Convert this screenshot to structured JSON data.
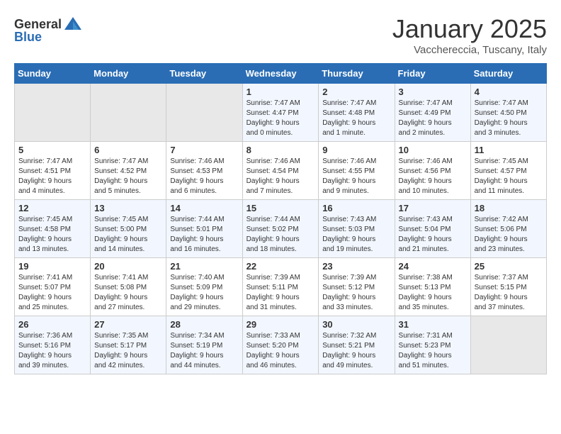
{
  "header": {
    "logo_general": "General",
    "logo_blue": "Blue",
    "month": "January 2025",
    "location": "Vacchereccia, Tuscany, Italy"
  },
  "days_of_week": [
    "Sunday",
    "Monday",
    "Tuesday",
    "Wednesday",
    "Thursday",
    "Friday",
    "Saturday"
  ],
  "weeks": [
    [
      {
        "day": "",
        "info": ""
      },
      {
        "day": "",
        "info": ""
      },
      {
        "day": "",
        "info": ""
      },
      {
        "day": "1",
        "info": "Sunrise: 7:47 AM\nSunset: 4:47 PM\nDaylight: 9 hours\nand 0 minutes."
      },
      {
        "day": "2",
        "info": "Sunrise: 7:47 AM\nSunset: 4:48 PM\nDaylight: 9 hours\nand 1 minute."
      },
      {
        "day": "3",
        "info": "Sunrise: 7:47 AM\nSunset: 4:49 PM\nDaylight: 9 hours\nand 2 minutes."
      },
      {
        "day": "4",
        "info": "Sunrise: 7:47 AM\nSunset: 4:50 PM\nDaylight: 9 hours\nand 3 minutes."
      }
    ],
    [
      {
        "day": "5",
        "info": "Sunrise: 7:47 AM\nSunset: 4:51 PM\nDaylight: 9 hours\nand 4 minutes."
      },
      {
        "day": "6",
        "info": "Sunrise: 7:47 AM\nSunset: 4:52 PM\nDaylight: 9 hours\nand 5 minutes."
      },
      {
        "day": "7",
        "info": "Sunrise: 7:46 AM\nSunset: 4:53 PM\nDaylight: 9 hours\nand 6 minutes."
      },
      {
        "day": "8",
        "info": "Sunrise: 7:46 AM\nSunset: 4:54 PM\nDaylight: 9 hours\nand 7 minutes."
      },
      {
        "day": "9",
        "info": "Sunrise: 7:46 AM\nSunset: 4:55 PM\nDaylight: 9 hours\nand 9 minutes."
      },
      {
        "day": "10",
        "info": "Sunrise: 7:46 AM\nSunset: 4:56 PM\nDaylight: 9 hours\nand 10 minutes."
      },
      {
        "day": "11",
        "info": "Sunrise: 7:45 AM\nSunset: 4:57 PM\nDaylight: 9 hours\nand 11 minutes."
      }
    ],
    [
      {
        "day": "12",
        "info": "Sunrise: 7:45 AM\nSunset: 4:58 PM\nDaylight: 9 hours\nand 13 minutes."
      },
      {
        "day": "13",
        "info": "Sunrise: 7:45 AM\nSunset: 5:00 PM\nDaylight: 9 hours\nand 14 minutes."
      },
      {
        "day": "14",
        "info": "Sunrise: 7:44 AM\nSunset: 5:01 PM\nDaylight: 9 hours\nand 16 minutes."
      },
      {
        "day": "15",
        "info": "Sunrise: 7:44 AM\nSunset: 5:02 PM\nDaylight: 9 hours\nand 18 minutes."
      },
      {
        "day": "16",
        "info": "Sunrise: 7:43 AM\nSunset: 5:03 PM\nDaylight: 9 hours\nand 19 minutes."
      },
      {
        "day": "17",
        "info": "Sunrise: 7:43 AM\nSunset: 5:04 PM\nDaylight: 9 hours\nand 21 minutes."
      },
      {
        "day": "18",
        "info": "Sunrise: 7:42 AM\nSunset: 5:06 PM\nDaylight: 9 hours\nand 23 minutes."
      }
    ],
    [
      {
        "day": "19",
        "info": "Sunrise: 7:41 AM\nSunset: 5:07 PM\nDaylight: 9 hours\nand 25 minutes."
      },
      {
        "day": "20",
        "info": "Sunrise: 7:41 AM\nSunset: 5:08 PM\nDaylight: 9 hours\nand 27 minutes."
      },
      {
        "day": "21",
        "info": "Sunrise: 7:40 AM\nSunset: 5:09 PM\nDaylight: 9 hours\nand 29 minutes."
      },
      {
        "day": "22",
        "info": "Sunrise: 7:39 AM\nSunset: 5:11 PM\nDaylight: 9 hours\nand 31 minutes."
      },
      {
        "day": "23",
        "info": "Sunrise: 7:39 AM\nSunset: 5:12 PM\nDaylight: 9 hours\nand 33 minutes."
      },
      {
        "day": "24",
        "info": "Sunrise: 7:38 AM\nSunset: 5:13 PM\nDaylight: 9 hours\nand 35 minutes."
      },
      {
        "day": "25",
        "info": "Sunrise: 7:37 AM\nSunset: 5:15 PM\nDaylight: 9 hours\nand 37 minutes."
      }
    ],
    [
      {
        "day": "26",
        "info": "Sunrise: 7:36 AM\nSunset: 5:16 PM\nDaylight: 9 hours\nand 39 minutes."
      },
      {
        "day": "27",
        "info": "Sunrise: 7:35 AM\nSunset: 5:17 PM\nDaylight: 9 hours\nand 42 minutes."
      },
      {
        "day": "28",
        "info": "Sunrise: 7:34 AM\nSunset: 5:19 PM\nDaylight: 9 hours\nand 44 minutes."
      },
      {
        "day": "29",
        "info": "Sunrise: 7:33 AM\nSunset: 5:20 PM\nDaylight: 9 hours\nand 46 minutes."
      },
      {
        "day": "30",
        "info": "Sunrise: 7:32 AM\nSunset: 5:21 PM\nDaylight: 9 hours\nand 49 minutes."
      },
      {
        "day": "31",
        "info": "Sunrise: 7:31 AM\nSunset: 5:23 PM\nDaylight: 9 hours\nand 51 minutes."
      },
      {
        "day": "",
        "info": ""
      }
    ]
  ]
}
